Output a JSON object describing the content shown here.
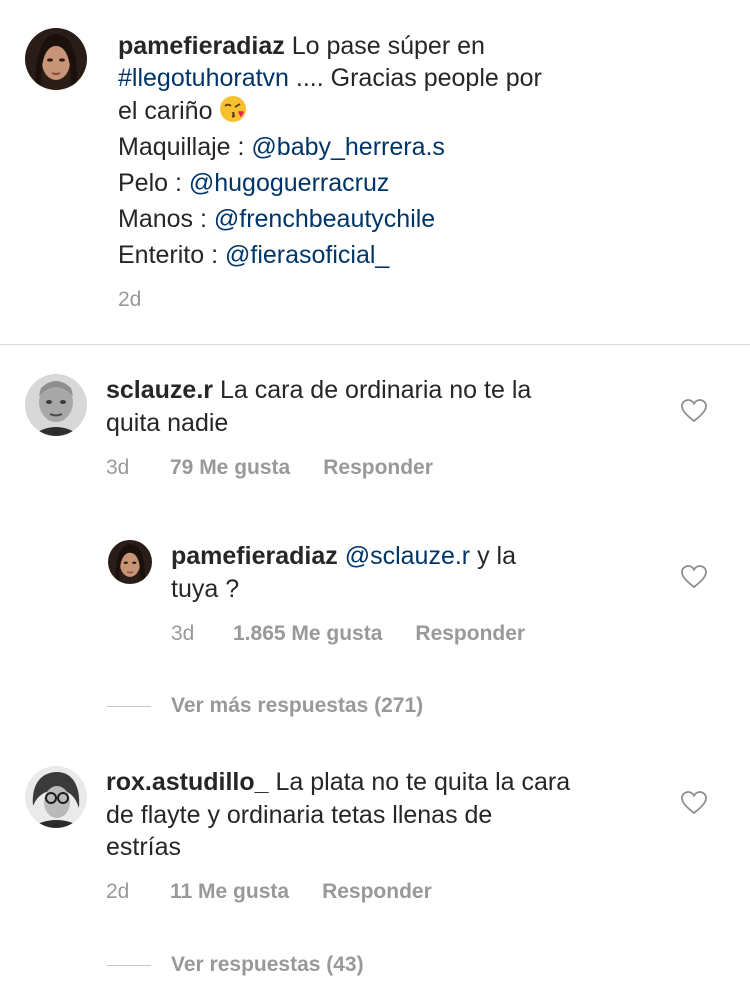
{
  "caption": {
    "username": "pamefieradiaz",
    "line1_text": " Lo pase súper en",
    "hashtag": "#llegotuhoratvn",
    "line2_text": " .... Gracias people por",
    "line3_text": "el cariño ",
    "emoji": "kissing-face-emoji",
    "credits": [
      {
        "label": "Maquillaje : ",
        "handle": "@baby_herrera.s"
      },
      {
        "label": "Pelo : ",
        "handle": "@hugoguerracruz"
      },
      {
        "label": "Manos : ",
        "handle": "@frenchbeautychile"
      },
      {
        "label": "Enterito : ",
        "handle": "@fierasoficial_"
      }
    ],
    "time": "2d"
  },
  "comments": [
    {
      "username": "sclauze.r",
      "text_line1": " La cara de ordinaria no te la",
      "text_line2": "quita nadie",
      "time": "3d",
      "likes": "79 Me gusta",
      "reply": "Responder"
    },
    {
      "username": "rox.astudillo_",
      "text_line1": " La plata no te quita la cara",
      "text_line2": "de flayte  y ordinaria  tetas llenas de",
      "text_line3": "estrías",
      "time": "2d",
      "likes": "11 Me gusta",
      "reply": "Responder",
      "view_replies": "Ver respuestas (43)"
    }
  ],
  "reply": {
    "username": "pamefieradiaz",
    "mention": "@sclauze.r",
    "text_line1": " y la",
    "text_line2": "tuya ?",
    "time": "3d",
    "likes": "1.865 Me gusta",
    "reply": "Responder"
  },
  "more_replies": "Ver más respuestas (271)",
  "colors": {
    "link": "#003569",
    "meta": "#999999",
    "text": "#262626",
    "divider": "#dbdbdb"
  }
}
